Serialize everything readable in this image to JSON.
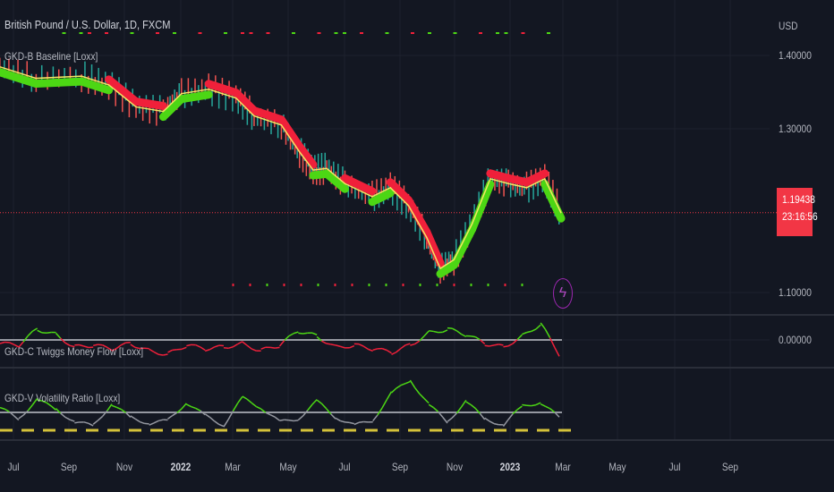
{
  "header": {
    "title": "British Pound / U.S. Dollar, 1D, FXCM",
    "currency": "USD"
  },
  "indicators": {
    "baseline": "GKD-B Baseline [Loxx]",
    "money_flow": "GKD-C Twiggs Money Flow [Loxx]",
    "volatility": "GKD-V Volatility Ratio [Loxx]"
  },
  "price_axis": {
    "labels": [
      "1.40000",
      "1.30000",
      "1.10000"
    ],
    "indicator_zero": "0.00000",
    "last_price": "1.19438",
    "countdown": "23:16:56"
  },
  "time_axis": {
    "labels": [
      "Jul",
      "Sep",
      "Nov",
      "2022",
      "Mar",
      "May",
      "Jul",
      "Sep",
      "Nov",
      "2023",
      "Mar",
      "May",
      "Jul",
      "Sep"
    ]
  },
  "colors": {
    "bg": "#131722",
    "bull": "#4cd714",
    "bear": "#f0203a",
    "baseline": "#f5e663",
    "grey": "#9598a1",
    "alert": "#f23645",
    "bolt": "#ab47bc"
  },
  "icons": {
    "alert": "lightning-icon"
  },
  "chart_data": {
    "type": "line",
    "price": {
      "dates": [
        "2021-06-16",
        "2021-07-26",
        "2021-09-14",
        "2021-10-14",
        "2021-11-13",
        "2021-12-13",
        "2022-01-02",
        "2022-02-01",
        "2022-03-03",
        "2022-03-23",
        "2022-04-22",
        "2022-05-12",
        "2022-05-27",
        "2022-06-11",
        "2022-07-01",
        "2022-07-31",
        "2022-08-20",
        "2022-09-09",
        "2022-09-29",
        "2022-10-14",
        "2022-10-29",
        "2022-11-18",
        "2022-12-08",
        "2022-12-28",
        "2023-01-17",
        "2023-02-06",
        "2023-02-24"
      ],
      "values": [
        1.384,
        1.368,
        1.371,
        1.359,
        1.329,
        1.323,
        1.347,
        1.353,
        1.341,
        1.317,
        1.305,
        1.27,
        1.247,
        1.249,
        1.23,
        1.214,
        1.225,
        1.203,
        1.165,
        1.129,
        1.139,
        1.181,
        1.236,
        1.23,
        1.225,
        1.236,
        1.194
      ],
      "trend": [
        1,
        1,
        1,
        0,
        0,
        1,
        1,
        0,
        0,
        0,
        0,
        0,
        1,
        1,
        0,
        1,
        0,
        0,
        0,
        1,
        1,
        1,
        0,
        0,
        0,
        1,
        0
      ]
    },
    "money_flow": [
      -0.2,
      -0.3,
      0.6,
      0.3,
      -0.4,
      -0.3,
      -0.5,
      -0.2,
      -0.6,
      -0.8,
      -0.3,
      -0.5,
      -0.4,
      -0.2,
      -0.6,
      -0.3,
      0.5,
      0.2,
      -0.4,
      -0.3,
      -0.5,
      -0.7,
      -0.3,
      0.4,
      0.6,
      0.3,
      -0.2,
      -0.4,
      0.2,
      0.9,
      -0.8
    ],
    "volatility": [
      0.3,
      -0.4,
      0.8,
      0.2,
      -0.6,
      -0.8,
      0.5,
      -0.3,
      -0.7,
      -0.5,
      0.6,
      -0.2,
      -0.8,
      0.9,
      0.3,
      -0.6,
      -0.4,
      0.7,
      -0.3,
      -0.8,
      -0.5,
      1.2,
      2.0,
      0.5,
      -0.6,
      0.7,
      -0.4,
      -0.8,
      0.4,
      0.6,
      -0.3
    ]
  }
}
